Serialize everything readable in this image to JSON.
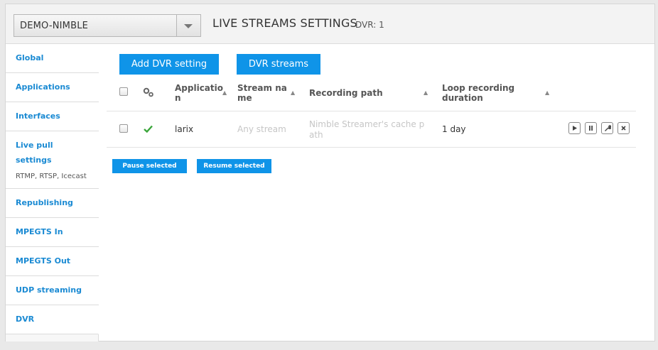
{
  "header": {
    "server_name": "DEMO-NIMBLE",
    "title": "LIVE STREAMS SETTINGS",
    "count_label": "DVR: 1"
  },
  "sidebar": {
    "items": [
      {
        "label": "Global"
      },
      {
        "label": "Applications"
      },
      {
        "label": "Interfaces"
      },
      {
        "label": "Live pull settings",
        "label_line1": "Live pull",
        "label_line2": "settings",
        "sub": "RTMP, RTSP, Icecast"
      },
      {
        "label": "Republishing"
      },
      {
        "label": "MPEGTS In"
      },
      {
        "label": "MPEGTS Out"
      },
      {
        "label": "UDP streaming"
      },
      {
        "label": "DVR"
      }
    ],
    "active": "DVR"
  },
  "toolbar": {
    "add_label": "Add DVR setting",
    "streams_label": "DVR streams"
  },
  "table": {
    "headers": {
      "application": [
        "Applicatio",
        "n"
      ],
      "stream_name": [
        "Stream na",
        "me"
      ],
      "recording_path": "Recording path",
      "loop_duration": [
        "Loop recording",
        "duration"
      ]
    },
    "rows": [
      {
        "status": "ok",
        "application": "larix",
        "stream_name": "Any stream",
        "recording_path": [
          "Nimble Streamer's cache p",
          "ath"
        ],
        "loop_duration": "1 day"
      }
    ]
  },
  "bulk": {
    "pause_label": "Pause selected",
    "resume_label": "Resume selected"
  },
  "colors": {
    "accent": "#0f94e8",
    "link": "#1a8ad3",
    "ok": "#3aa53a"
  }
}
